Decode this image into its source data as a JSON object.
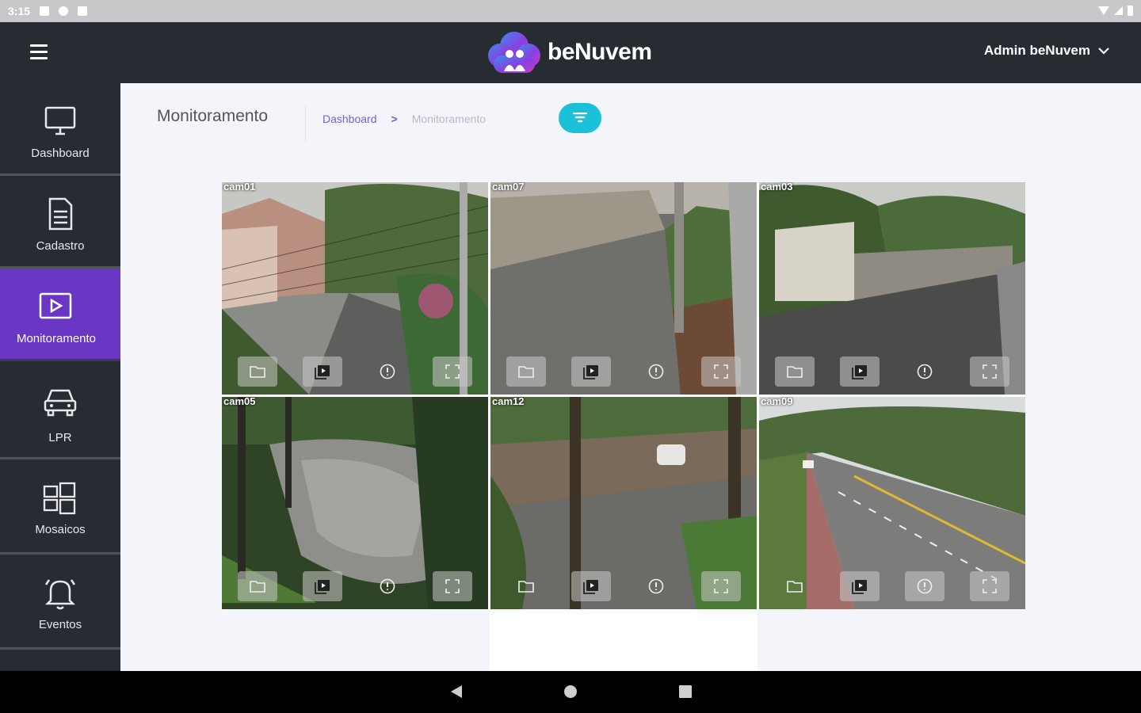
{
  "status_bar": {
    "time": "3:15"
  },
  "header": {
    "menu_icon": "hamburger-icon",
    "brand": "beNuvem",
    "user": "Admin beNuvem",
    "user_chevron": "chevron-down-icon"
  },
  "sidebar": {
    "items": [
      {
        "label": "Dashboard",
        "icon": "monitor-icon",
        "active": false
      },
      {
        "label": "Cadastro",
        "icon": "document-icon",
        "active": false
      },
      {
        "label": "Monitoramento",
        "icon": "video-icon",
        "active": true
      },
      {
        "label": "LPR",
        "icon": "car-icon",
        "active": false
      },
      {
        "label": "Mosaicos",
        "icon": "mosaic-icon",
        "active": false
      },
      {
        "label": "Eventos",
        "icon": "bell-icon",
        "active": false
      }
    ]
  },
  "page": {
    "title": "Monitoramento",
    "breadcrumb": {
      "link": "Dashboard",
      "separator": ">",
      "current": "Monitoramento"
    },
    "filter_icon": "filter-icon"
  },
  "cameras": [
    {
      "label": "cam01",
      "timestamp": ""
    },
    {
      "label": "cam07",
      "timestamp": ""
    },
    {
      "label": "cam03",
      "timestamp": ""
    },
    {
      "label": "cam05",
      "timestamp": ""
    },
    {
      "label": "cam12",
      "timestamp": ""
    },
    {
      "label": "cam09",
      "timestamp": ""
    }
  ],
  "camera_controls": [
    "folder-icon",
    "playback-icon",
    "info-icon",
    "fullscreen-icon"
  ],
  "colors": {
    "header_bg": "#272c33",
    "active_item": "#6a37c4",
    "filter_button": "#1bc1d8",
    "link": "#7a5bd0"
  }
}
